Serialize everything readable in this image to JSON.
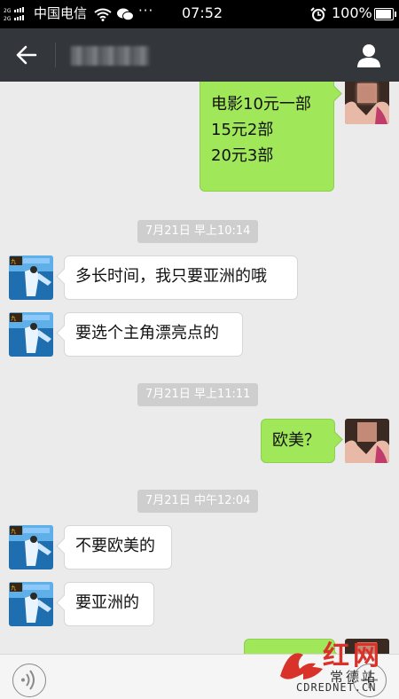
{
  "status_bar": {
    "signal_label": "2G 2G",
    "carrier": "中国电信",
    "dots": "···",
    "time": "07:52",
    "battery": "100%"
  },
  "title_bar": {
    "contact_name": "",
    "back_icon": "arrow-left-icon",
    "profile_icon": "person-icon",
    "bg_color": "#33373b"
  },
  "messages": [
    {
      "type": "out",
      "text": "电影10元一部\n15元2部\n20元3部"
    },
    {
      "type": "timestamp",
      "text": "7月21日 早上10:14"
    },
    {
      "type": "in",
      "text": "多长时间，我只要亚洲的哦"
    },
    {
      "type": "in",
      "text": "要选个主角漂亮点的"
    },
    {
      "type": "timestamp",
      "text": "7月21日 早上11:11"
    },
    {
      "type": "out",
      "text": "欧美？"
    },
    {
      "type": "timestamp",
      "text": "7月21日 中午12:04"
    },
    {
      "type": "in",
      "text": "不要欧美的"
    },
    {
      "type": "in",
      "text": "要亚洲的"
    }
  ],
  "input_bar": {
    "voice_icon": "voice-icon",
    "plus_icon": "plus-icon"
  },
  "watermark": {
    "line1": "红网",
    "line2": "常德站",
    "line3": "CDREDNET.CN"
  },
  "colors": {
    "outgoing_bubble": "#a0e75a",
    "incoming_bubble": "#ffffff",
    "chat_bg": "#ebebeb",
    "timestamp_bg": "#cecece",
    "watermark_red": "#d9322a"
  }
}
